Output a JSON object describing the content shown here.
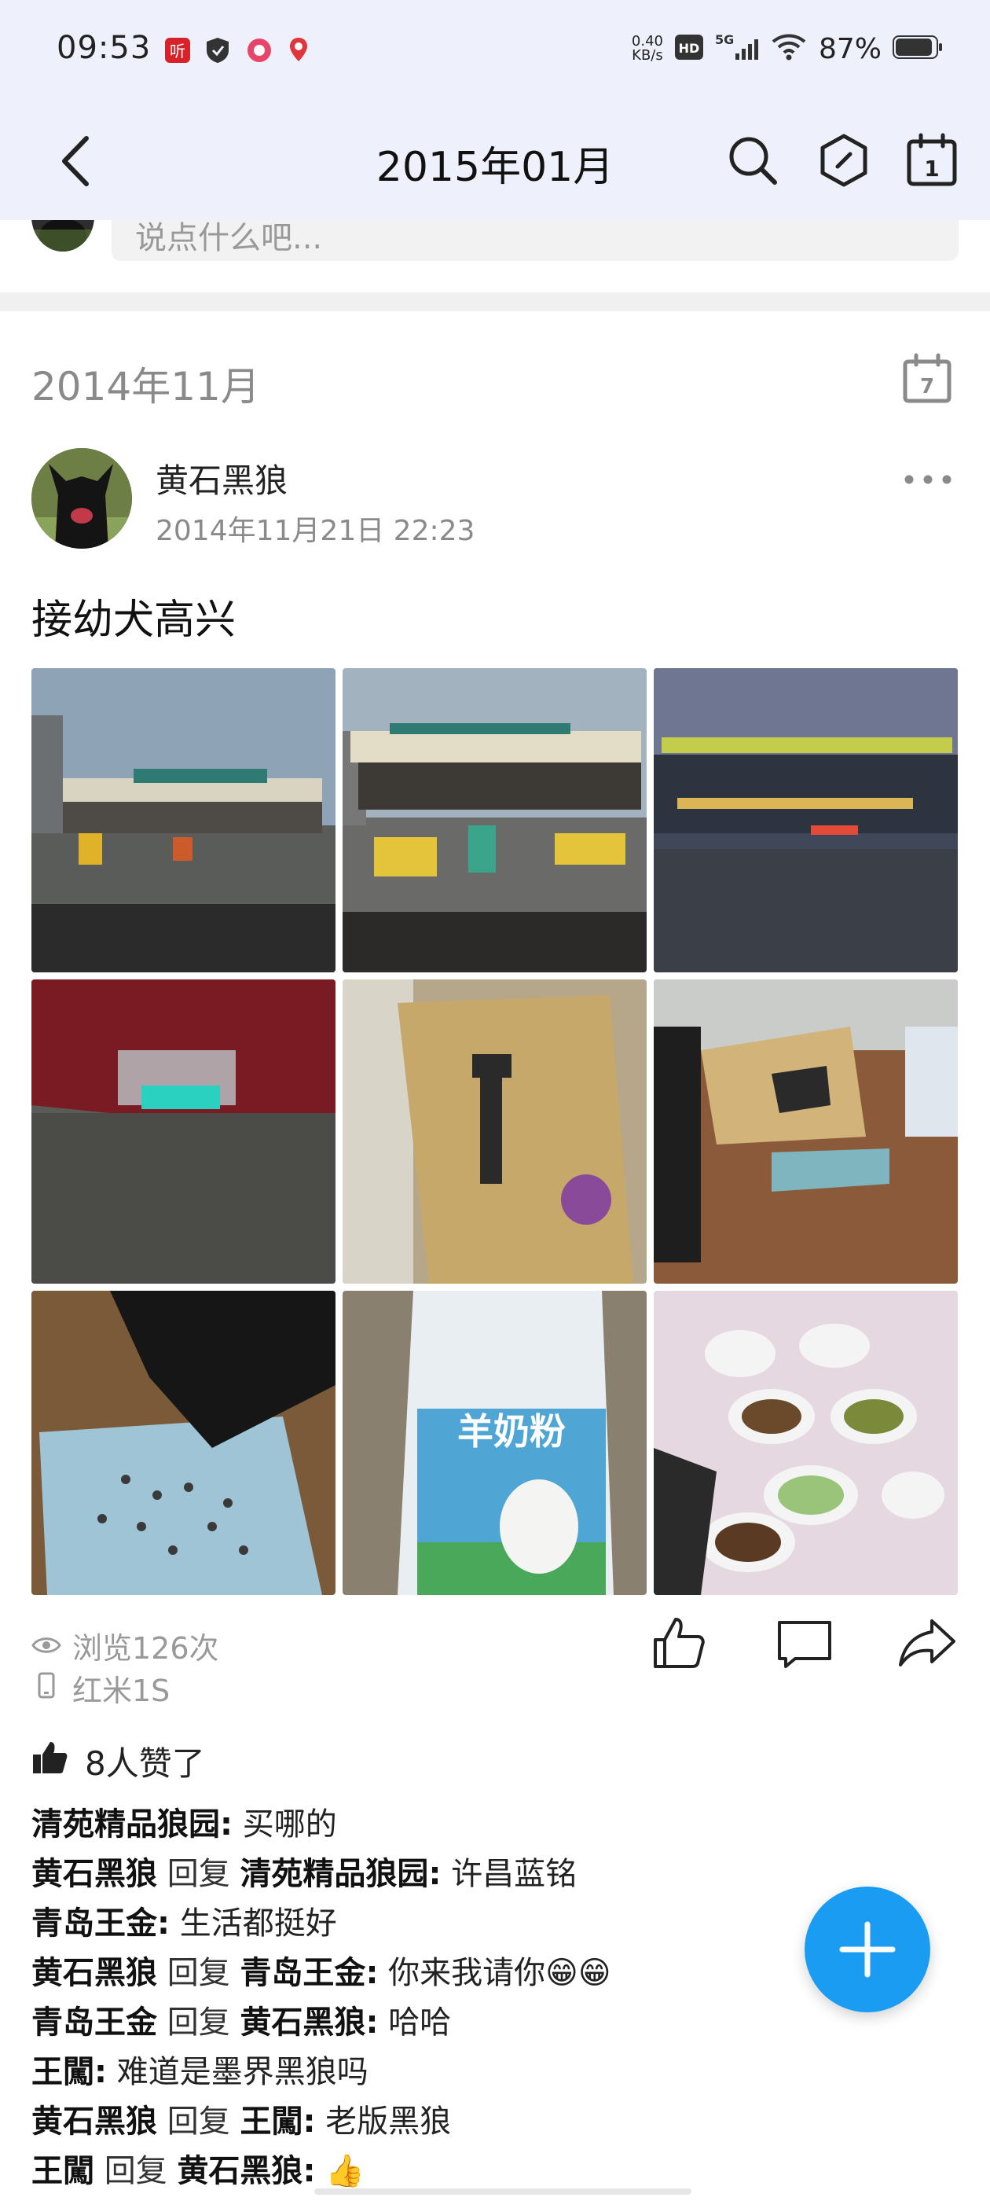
{
  "status_bar": {
    "time": "09:53",
    "net_speed_value": "0.40",
    "net_speed_unit": "KB/s",
    "hd": "HD",
    "network": "5G",
    "battery": "87%"
  },
  "nav": {
    "title": "2015年01月"
  },
  "composer": {
    "placeholder": "说点什么吧..."
  },
  "section": {
    "month": "2014年11月",
    "calendar_day": "7"
  },
  "post": {
    "author": "黄石黑狼",
    "time": "2014年11月21日 22:23",
    "text": "接幼犬高兴",
    "photos": [
      "toll-gate-1",
      "toll-gate-2",
      "service-area-night",
      "red-car",
      "cardboard-box",
      "box-and-tray",
      "puppy-eating",
      "goat-milk-powder",
      "dinner-table"
    ],
    "photo_label_milk": "羊奶粉",
    "views": "浏览126次",
    "device": "红米1S",
    "likes": "8人赞了"
  },
  "comments": [
    {
      "from": "清苑精品狼园",
      "reply": "",
      "to": "",
      "text": "买哪的"
    },
    {
      "from": "黄石黑狼",
      "reply": "回复",
      "to": "清苑精品狼园",
      "text": "许昌蓝铭"
    },
    {
      "from": "青岛王金",
      "reply": "",
      "to": "",
      "text": "生活都挺好"
    },
    {
      "from": "黄石黑狼",
      "reply": "回复",
      "to": "青岛王金",
      "text": "你来我请你😁😁"
    },
    {
      "from": "青岛王金",
      "reply": "回复",
      "to": "黄石黑狼",
      "text": "哈哈"
    },
    {
      "from": "王闖",
      "reply": "",
      "to": "",
      "text": "难道是墨界黑狼吗"
    },
    {
      "from": "黄石黑狼",
      "reply": "回复",
      "to": "王闖",
      "text": "老版黑狼"
    },
    {
      "from": "王闖",
      "reply": "回复",
      "to": "黄石黑狼",
      "text": "👍"
    }
  ],
  "colors": {
    "header_bg": "#eef1fb",
    "fab": "#1a9cf2",
    "muted_text": "#8a8a8a"
  }
}
